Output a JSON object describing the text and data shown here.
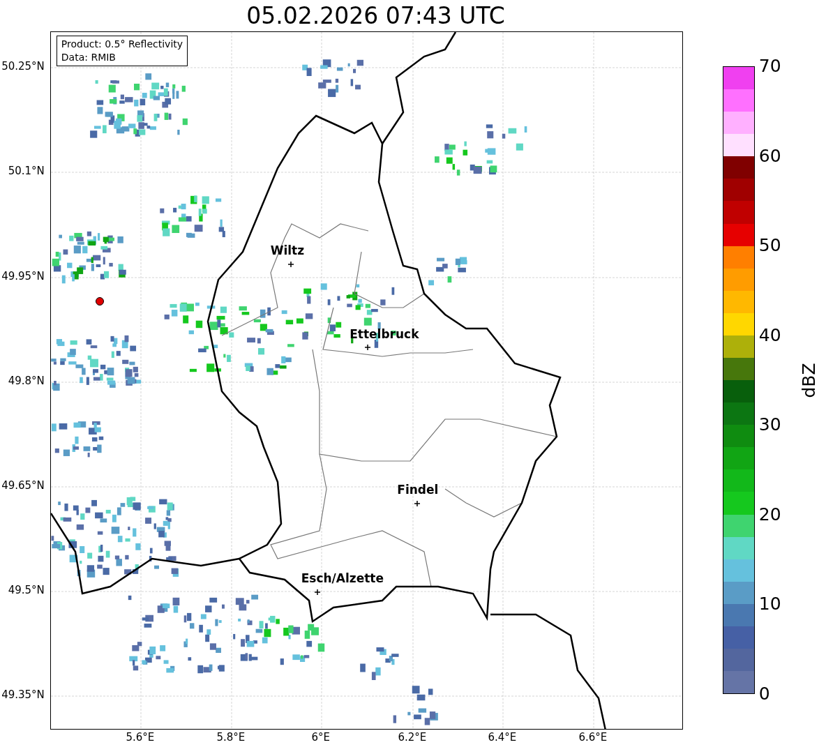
{
  "title": "05.02.2026 07:43 UTC",
  "info_box": {
    "lines": [
      "Product: 0.5° Reflectivity",
      "Data: RMIB"
    ]
  },
  "cities": [
    {
      "name": "Wiltz"
    },
    {
      "name": "Ettelbruck"
    },
    {
      "name": "Findel"
    },
    {
      "name": "Esch/Alzette"
    }
  ],
  "y_ticks": [
    "50.25°N",
    "50.1°N",
    "49.95°N",
    "49.8°N",
    "49.65°N",
    "49.5°N",
    "49.35°N"
  ],
  "x_ticks": [
    "5.6°E",
    "5.8°E",
    "6°E",
    "6.2°E",
    "6.4°E",
    "6.6°E"
  ],
  "colorbar": {
    "label": "dBZ",
    "ticks": [
      "70",
      "60",
      "50",
      "40",
      "30",
      "20",
      "10",
      "0"
    ],
    "segments": [
      {
        "color": "#f040f0"
      },
      {
        "color": "#ff70ff"
      },
      {
        "color": "#ffb0ff"
      },
      {
        "color": "#ffe0ff"
      },
      {
        "color": "#800000"
      },
      {
        "color": "#a00000"
      },
      {
        "color": "#c00000"
      },
      {
        "color": "#e60000"
      },
      {
        "color": "#ff7f00"
      },
      {
        "color": "#ff9c00"
      },
      {
        "color": "#ffb800"
      },
      {
        "color": "#ffd700"
      },
      {
        "color": "#adb00a"
      },
      {
        "color": "#47770c"
      },
      {
        "color": "#085f0c"
      },
      {
        "color": "#0c7612"
      },
      {
        "color": "#0f8c10"
      },
      {
        "color": "#11a514"
      },
      {
        "color": "#12b81a"
      },
      {
        "color": "#15c81e"
      },
      {
        "color": "#3fd46f"
      },
      {
        "color": "#60d8c4"
      },
      {
        "color": "#65c1dd"
      },
      {
        "color": "#5a9cc6"
      },
      {
        "color": "#4a78b0"
      },
      {
        "color": "#4660a5"
      },
      {
        "color": "#53669e"
      },
      {
        "color": "#6574a6"
      }
    ]
  }
}
